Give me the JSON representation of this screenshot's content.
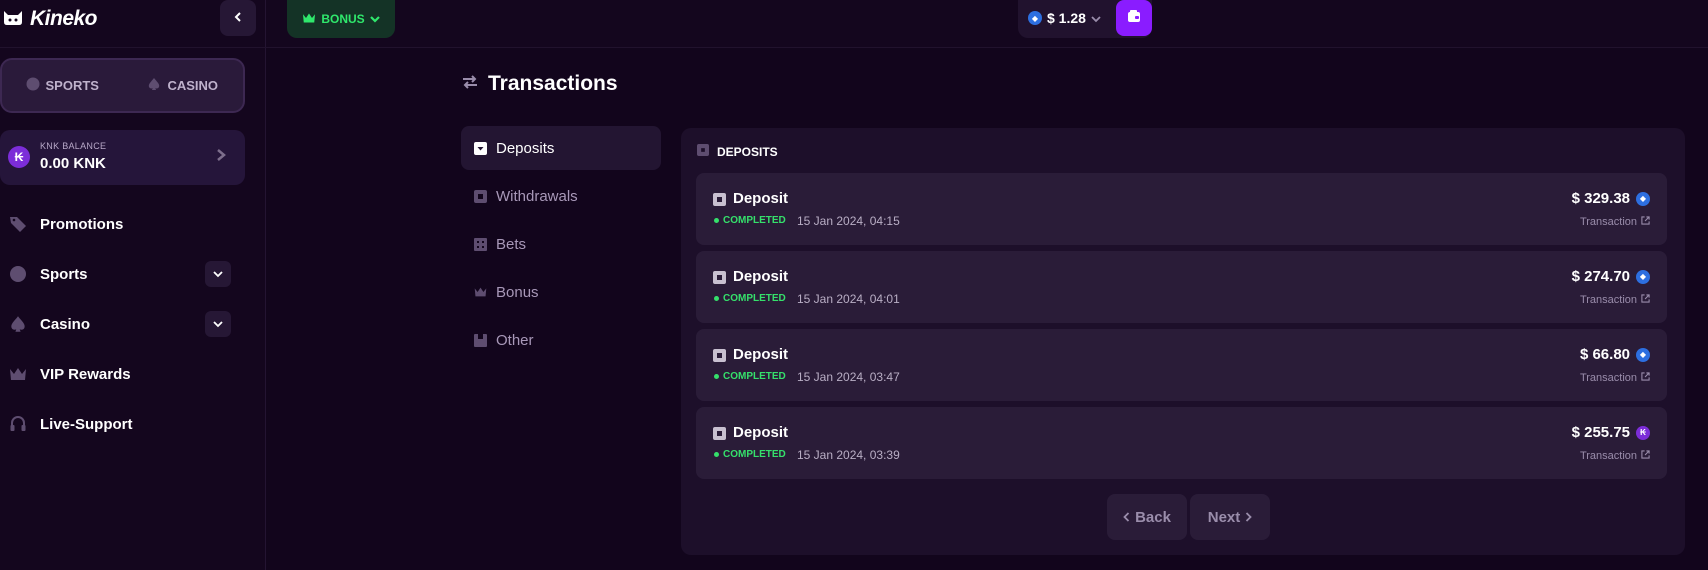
{
  "app": {
    "name": "Kineko"
  },
  "sidebar": {
    "modes": [
      {
        "label": "SPORTS",
        "icon": "ball-icon"
      },
      {
        "label": "CASINO",
        "icon": "spade-icon"
      }
    ],
    "knk_balance": {
      "label": "KNK BALANCE",
      "value": "0.00 KNK",
      "icon_glyph": "₭"
    },
    "nav": [
      {
        "label": "Promotions",
        "icon": "tag-icon",
        "expandable": false
      },
      {
        "label": "Sports",
        "icon": "ball-icon",
        "expandable": true
      },
      {
        "label": "Casino",
        "icon": "spade-icon",
        "expandable": true
      },
      {
        "label": "VIP Rewards",
        "icon": "crown-icon",
        "expandable": false
      },
      {
        "label": "Live-Support",
        "icon": "headset-icon",
        "expandable": false
      }
    ]
  },
  "topbar": {
    "bonus_label": "BONUS",
    "wallet_balance": "$ 1.28"
  },
  "page": {
    "title": "Transactions",
    "tabs": [
      {
        "label": "Deposits",
        "icon": "deposit-icon",
        "active": true
      },
      {
        "label": "Withdrawals",
        "icon": "withdraw-icon",
        "active": false
      },
      {
        "label": "Bets",
        "icon": "bets-icon",
        "active": false
      },
      {
        "label": "Bonus",
        "icon": "crown-icon",
        "active": false
      },
      {
        "label": "Other",
        "icon": "other-icon",
        "active": false
      }
    ]
  },
  "panel": {
    "header": "DEPOSITS",
    "transactions": [
      {
        "title": "Deposit",
        "status": "COMPLETED",
        "date": "15 Jan 2024, 04:15",
        "amount": "$ 329.38",
        "coin": "eth",
        "link": "Transaction"
      },
      {
        "title": "Deposit",
        "status": "COMPLETED",
        "date": "15 Jan 2024, 04:01",
        "amount": "$ 274.70",
        "coin": "eth",
        "link": "Transaction"
      },
      {
        "title": "Deposit",
        "status": "COMPLETED",
        "date": "15 Jan 2024, 03:47",
        "amount": "$ 66.80",
        "coin": "eth",
        "link": "Transaction"
      },
      {
        "title": "Deposit",
        "status": "COMPLETED",
        "date": "15 Jan 2024, 03:39",
        "amount": "$ 255.75",
        "coin": "knk",
        "link": "Transaction"
      }
    ],
    "pagination": {
      "back_label": "Back",
      "next_label": "Next"
    }
  },
  "colors": {
    "background": "#12051c",
    "accent_purple": "#8a1cff",
    "bonus_green": "#2fe86c",
    "status_green": "#35e06b",
    "eth_blue": "#2d6fe0"
  }
}
